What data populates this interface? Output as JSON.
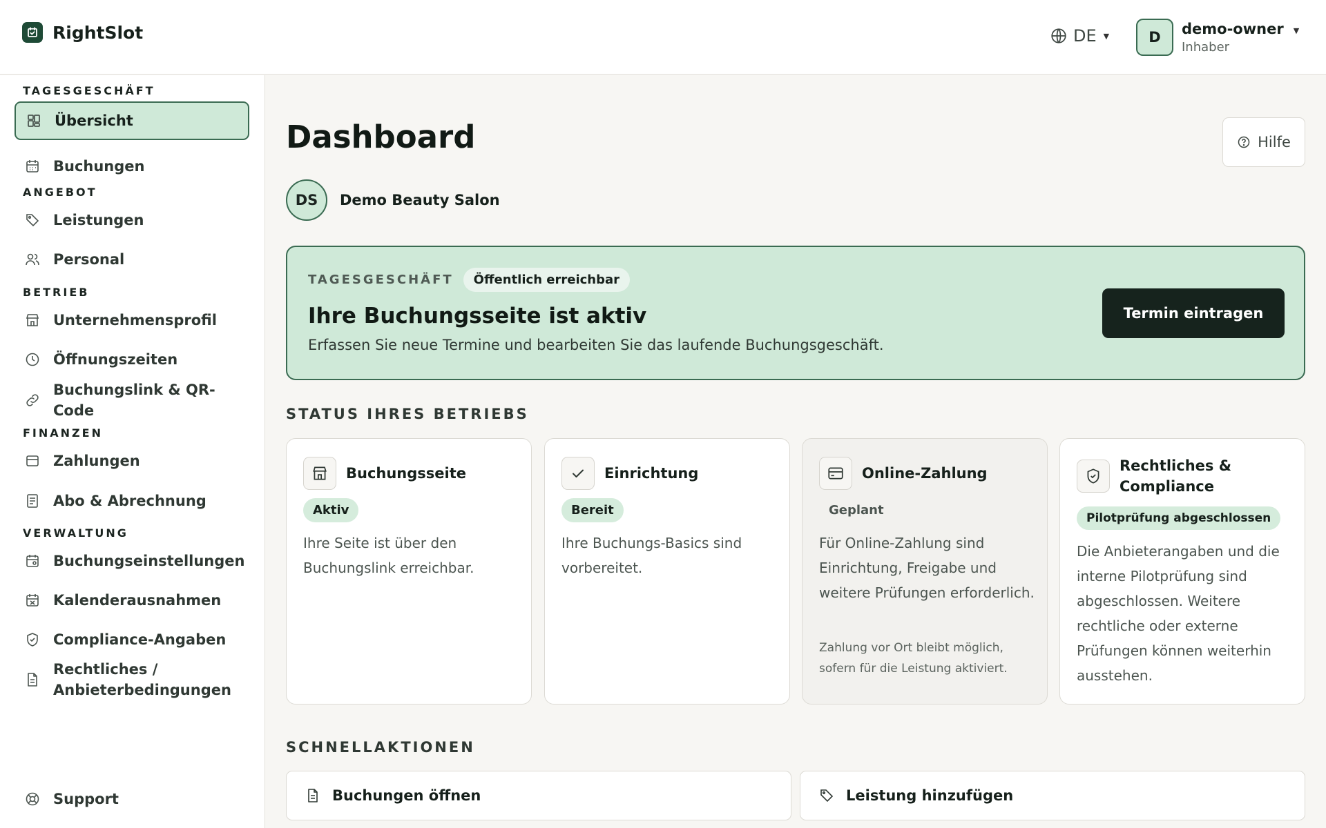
{
  "app": {
    "name": "RightSlot"
  },
  "header": {
    "language": "DE",
    "user": {
      "initial": "D",
      "name": "demo-owner",
      "role": "Inhaber"
    }
  },
  "sidebar": {
    "sections": [
      {
        "title": "TAGESGESCHÄFT",
        "items": [
          {
            "label": "Übersicht",
            "icon": "dashboard-icon",
            "active": true
          },
          {
            "label": "Buchungen",
            "icon": "calendar-icon"
          }
        ]
      },
      {
        "title": "ANGEBOT",
        "items": [
          {
            "label": "Leistungen",
            "icon": "tag-icon"
          },
          {
            "label": "Personal",
            "icon": "users-icon"
          }
        ]
      },
      {
        "title": "BETRIEB",
        "items": [
          {
            "label": "Unternehmensprofil",
            "icon": "store-icon"
          },
          {
            "label": "Öffnungszeiten",
            "icon": "clock-icon"
          },
          {
            "label": "Buchungslink & QR-Code",
            "icon": "link-icon"
          }
        ]
      },
      {
        "title": "FINANZEN",
        "items": [
          {
            "label": "Zahlungen",
            "icon": "card-icon"
          },
          {
            "label": "Abo & Abrechnung",
            "icon": "receipt-icon"
          }
        ]
      },
      {
        "title": "VERWALTUNG",
        "items": [
          {
            "label": "Buchungseinstellungen",
            "icon": "calendar-settings-icon"
          },
          {
            "label": "Kalenderausnahmen",
            "icon": "calendar-off-icon"
          },
          {
            "label": "Compliance-Angaben",
            "icon": "shield-icon"
          },
          {
            "label": "Rechtliches / Anbieterbedingungen",
            "icon": "document-icon"
          }
        ]
      }
    ],
    "support": "Support"
  },
  "main": {
    "title": "Dashboard",
    "help": "Hilfe",
    "business": {
      "initials": "DS",
      "name": "Demo Beauty Salon"
    },
    "banner": {
      "eyebrow": "TAGESGESCHÄFT",
      "pill": "Öffentlich erreichbar",
      "title": "Ihre Buchungsseite ist aktiv",
      "description": "Erfassen Sie neue Termine und bearbeiten Sie das laufende Buchungsgeschäft.",
      "button": "Termin eintragen"
    },
    "status_heading": "STATUS IHRES BETRIEBS",
    "cards": [
      {
        "title": "Buchungsseite",
        "status": "Aktiv",
        "text": "Ihre Seite ist über den Buchungslink erreichbar."
      },
      {
        "title": "Einrichtung",
        "status": "Bereit",
        "text": "Ihre Buchungs-Basics sind vorbereitet."
      },
      {
        "title": "Online-Zahlung",
        "status": "Geplant",
        "text": "Für Online-Zahlung sind Einrichtung, Freigabe und weitere Prüfungen erforderlich.",
        "note": "Zahlung vor Ort bleibt möglich, sofern für die Leistung aktiviert."
      },
      {
        "title": "Rechtliches & Compliance",
        "status": "Pilotprüfung abgeschlossen",
        "text": "Die Anbieterangaben und die interne Pilotprüfung sind abgeschlossen. Weitere rechtliche oder externe Prüfungen können weiterhin ausstehen."
      }
    ],
    "quick_heading": "SCHNELLAKTIONEN",
    "quick_actions": [
      {
        "label": "Buchungen öffnen",
        "icon": "document-icon"
      },
      {
        "label": "Leistung hinzufügen",
        "icon": "tag-icon"
      }
    ]
  },
  "colors": {
    "accent": "#cfe9d8",
    "accent_border": "#3a6b52",
    "primary": "#16231d",
    "background": "#f7f6f3"
  }
}
